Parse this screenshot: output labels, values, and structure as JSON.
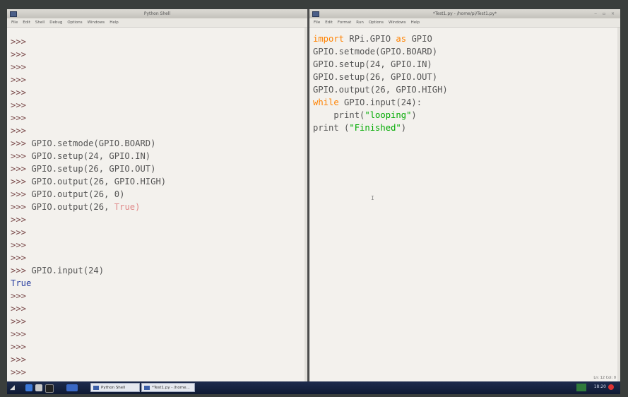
{
  "shell_window": {
    "title": "Python Shell",
    "menu": [
      "File",
      "Edit",
      "Shell",
      "Debug",
      "Options",
      "Windows",
      "Help"
    ],
    "lines": [
      [
        {
          "t": ">>>",
          "c": "prompt"
        }
      ],
      [
        {
          "t": ">>>",
          "c": "prompt"
        }
      ],
      [
        {
          "t": ">>>",
          "c": "prompt"
        }
      ],
      [
        {
          "t": ">>>",
          "c": "prompt"
        }
      ],
      [
        {
          "t": ">>>",
          "c": "prompt"
        }
      ],
      [
        {
          "t": ">>>",
          "c": "prompt"
        }
      ],
      [
        {
          "t": ">>>",
          "c": "prompt"
        }
      ],
      [
        {
          "t": ">>>",
          "c": "prompt"
        }
      ],
      [
        {
          "t": ">>> ",
          "c": "prompt"
        },
        {
          "t": "GPIO.setmode(GPIO.BOARD)",
          "c": ""
        }
      ],
      [
        {
          "t": ">>> ",
          "c": "prompt"
        },
        {
          "t": "GPIO.setup(24, GPIO.IN)",
          "c": ""
        }
      ],
      [
        {
          "t": ">>> ",
          "c": "prompt"
        },
        {
          "t": "GPIO.setup(26, GPIO.OUT)",
          "c": ""
        }
      ],
      [
        {
          "t": ">>> ",
          "c": "prompt"
        },
        {
          "t": "GPIO.output(26, GPIO.HIGH)",
          "c": ""
        }
      ],
      [
        {
          "t": ">>> ",
          "c": "prompt"
        },
        {
          "t": "GPIO.output(26, 0)",
          "c": ""
        }
      ],
      [
        {
          "t": ">>> ",
          "c": "prompt"
        },
        {
          "t": "GPIO.output(26, ",
          "c": ""
        },
        {
          "t": "True)",
          "c": "faded"
        }
      ],
      [
        {
          "t": ">>>",
          "c": "prompt"
        }
      ],
      [
        {
          "t": ">>>",
          "c": "prompt"
        }
      ],
      [
        {
          "t": ">>>",
          "c": "prompt"
        }
      ],
      [
        {
          "t": ">>>",
          "c": "prompt"
        }
      ],
      [
        {
          "t": ">>> ",
          "c": "prompt"
        },
        {
          "t": "GPIO.input(24)",
          "c": ""
        }
      ],
      [
        {
          "t": "True",
          "c": "out"
        }
      ],
      [
        {
          "t": ">>>",
          "c": "prompt"
        }
      ],
      [
        {
          "t": ">>>",
          "c": "prompt"
        }
      ],
      [
        {
          "t": ">>>",
          "c": "prompt"
        }
      ],
      [
        {
          "t": ">>>",
          "c": "prompt"
        }
      ],
      [
        {
          "t": ">>>",
          "c": "prompt"
        }
      ],
      [
        {
          "t": ">>>",
          "c": "prompt"
        }
      ],
      [
        {
          "t": ">>>",
          "c": "prompt"
        }
      ],
      [
        {
          "t": ">>>",
          "c": "prompt"
        }
      ]
    ]
  },
  "editor_window": {
    "title": "*Test1.py - /home/pi/Test1.py*",
    "menu": [
      "File",
      "Edit",
      "Format",
      "Run",
      "Options",
      "Windows",
      "Help"
    ],
    "lines": [
      [
        {
          "t": "import ",
          "c": "kw"
        },
        {
          "t": "RPi.GPIO ",
          "c": ""
        },
        {
          "t": "as ",
          "c": "kw"
        },
        {
          "t": "GPIO",
          "c": ""
        }
      ],
      [
        {
          "t": "GPIO.setmode(GPIO.BOARD)",
          "c": ""
        }
      ],
      [
        {
          "t": "GPIO.setup(24, GPIO.IN)",
          "c": ""
        }
      ],
      [
        {
          "t": "GPIO.setup(26, GPIO.OUT)",
          "c": ""
        }
      ],
      [
        {
          "t": "GPIO.output(26, GPIO.HIGH)",
          "c": ""
        }
      ],
      [
        {
          "t": "while ",
          "c": "kw"
        },
        {
          "t": "GPIO.input(24):",
          "c": ""
        }
      ],
      [
        {
          "t": "    print(",
          "c": ""
        },
        {
          "t": "\"looping\"",
          "c": "str"
        },
        {
          "t": ")",
          "c": ""
        }
      ],
      [
        {
          "t": "print (",
          "c": ""
        },
        {
          "t": "\"Finished\"",
          "c": "str"
        },
        {
          "t": ")",
          "c": ""
        }
      ]
    ],
    "status": "Ln: 12 Col: 0"
  },
  "taskbar": {
    "tasks": [
      "Python Shell",
      "*Test1.py - /home..."
    ],
    "clock": "18:20"
  }
}
